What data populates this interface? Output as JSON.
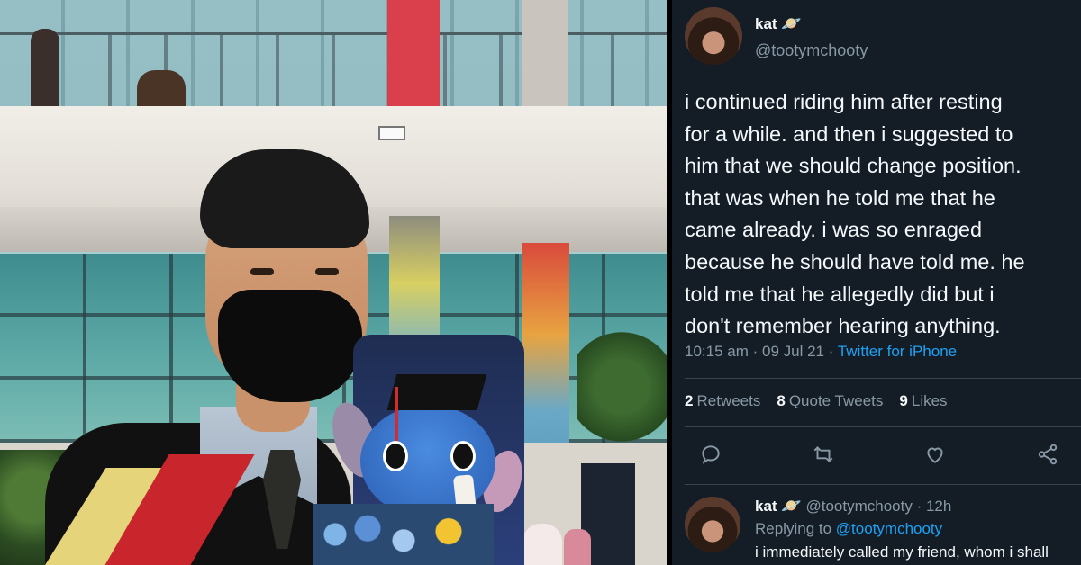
{
  "tweet": {
    "author_name": "kat",
    "author_emoji": "🪐",
    "handle": "@tootymchooty",
    "text_lines": [
      "i continued riding him after resting",
      "for a while. and then i suggested to",
      "him that we should change position.",
      "that was when he told me  that he",
      "came already. i was so enraged",
      "because he should have told me. he",
      "told me that he allegedly did but i",
      "don't remember hearing anything."
    ],
    "time": "10:15 am",
    "date": "09 Jul 21",
    "source": "Twitter for iPhone",
    "stats": {
      "retweets_count": "2",
      "retweets_label": "Retweets",
      "quotes_count": "8",
      "quotes_label": "Quote Tweets",
      "likes_count": "9",
      "likes_label": "Likes"
    },
    "actions": [
      "reply-icon",
      "retweet-icon",
      "like-icon",
      "share-icon"
    ]
  },
  "reply": {
    "author_name": "kat",
    "author_emoji": "🪐",
    "handle": "@tootymchooty",
    "age": "12h",
    "replying_prefix": "Replying to",
    "replying_to": "@tootymchooty",
    "text": "i immediately called my friend, whom i shall"
  },
  "colors": {
    "background": "#141d26",
    "text": "#f5f8fa",
    "muted": "#8899a6",
    "link": "#1da1f2",
    "divider": "#38444d"
  }
}
